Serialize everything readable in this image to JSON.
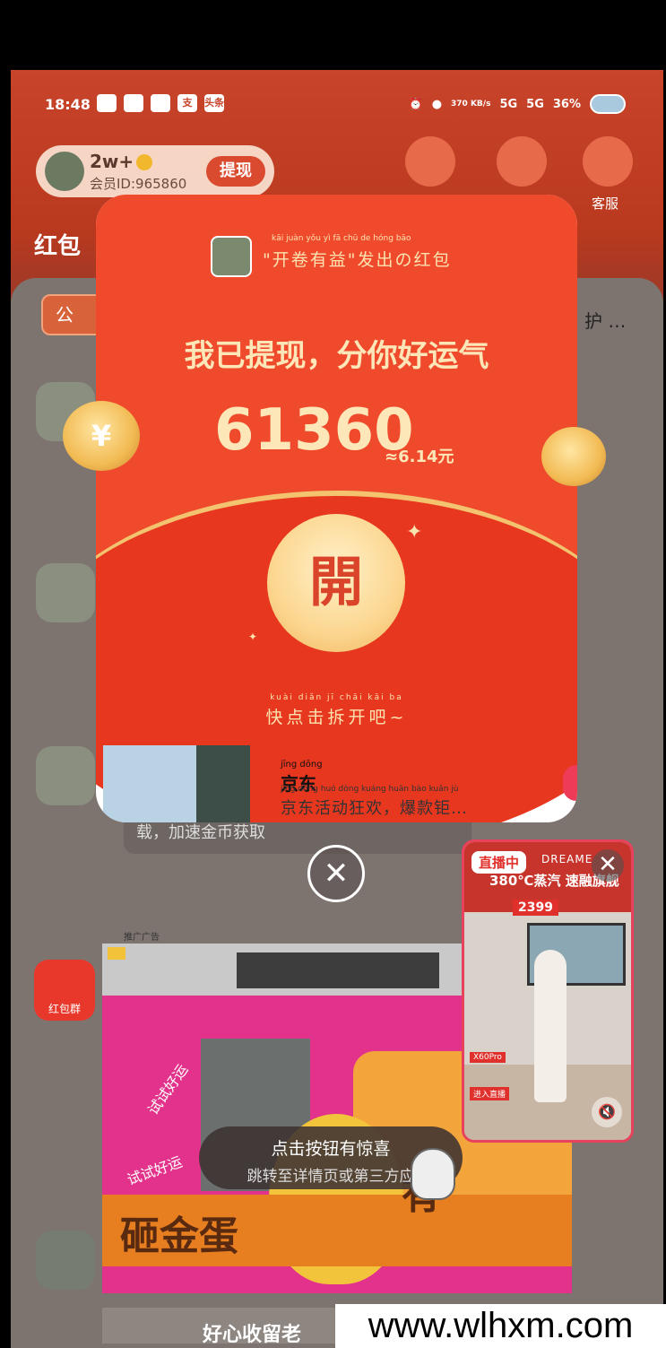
{
  "status_bar": {
    "time": "18:48",
    "app_icons": [
      "bili-icon",
      "bird-icon",
      "wechat-icon",
      "alipay-icon",
      "toutiao-icon"
    ],
    "app_icon_labels": [
      "",
      "",
      "",
      "支",
      "头条"
    ],
    "net_speed": "370 KB/s",
    "network_1": "5G",
    "network_2": "5G",
    "battery": "36%"
  },
  "header": {
    "member_count": "2w+",
    "member_id": "会员ID:965860",
    "withdraw_label": "提现",
    "service_label": "客服",
    "page_title": "红包"
  },
  "background": {
    "tag_label": "公",
    "side_text": "护 …",
    "bar_text": "载，加速金币获取",
    "redpack_badge": "红包群",
    "ad_heading": "推广广告",
    "bottom_caption": "好心收留老"
  },
  "red_packet": {
    "sender_pinyin": "kāi juàn yǒu yì fā chū de hóng bāo",
    "sender_text": "\"开卷有益\"发出の红包",
    "headline": "我已提现，分你好运气",
    "amount": "61360",
    "approx": "≈6.14元",
    "open_label": "開",
    "hint_pinyin": "kuài diǎn jī chāi kāi ba",
    "hint_text": "快点击拆开吧~",
    "sponsor_pinyin": "jīng dōng",
    "sponsor_title": "京东",
    "sponsor_desc_pinyin": "jīng dōng huó dòng kuáng huān bào kuǎn jù",
    "sponsor_desc": "京东活动狂欢，爆款钜…"
  },
  "ad": {
    "cta_line1": "点击按钮有惊喜",
    "cta_line2": "跳转至详情页或第三方应",
    "big_text": "砸金蛋",
    "big_text2": "有",
    "side_text": "试试好运",
    "side_text2": "试试好运"
  },
  "live": {
    "badge": "直播中",
    "brand": "DREAME",
    "headline": "380℃蒸汽 速融旗舰",
    "price": "2399",
    "model": "X60Pro",
    "label": "进入直播"
  },
  "watermark": "www.wlhxm.com"
}
